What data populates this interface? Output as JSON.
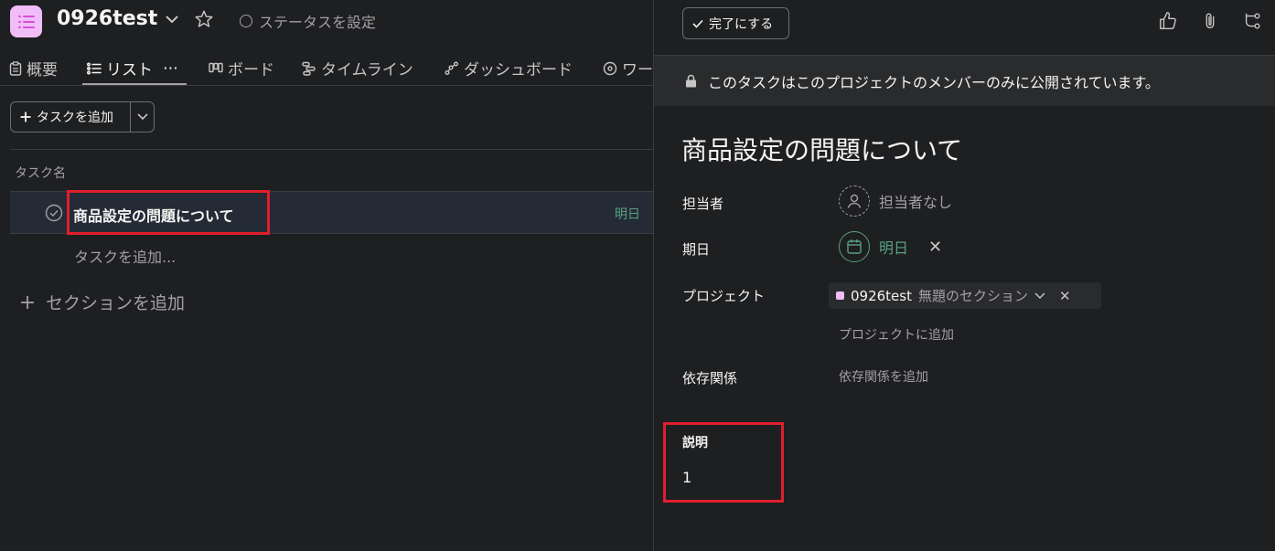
{
  "project": {
    "title": "0926test",
    "status_label": "ステータスを設定",
    "icon_color": "#f1bdf8"
  },
  "tabs": [
    {
      "label": "概要",
      "icon": "clipboard-icon"
    },
    {
      "label": "リスト",
      "icon": "list-icon",
      "active": true,
      "more": "⋯"
    },
    {
      "label": "ボード",
      "icon": "board-icon"
    },
    {
      "label": "タイムライン",
      "icon": "timeline-icon"
    },
    {
      "label": "ダッシュボード",
      "icon": "dashboard-icon"
    },
    {
      "label": "ワー",
      "icon": "workflow-icon"
    }
  ],
  "list": {
    "add_task_label": "タスクを追加",
    "column_header": "タスク名",
    "tasks": [
      {
        "name": "商品設定の問題について",
        "due": "明日"
      }
    ],
    "add_subtask_label": "タスクを追加...",
    "add_section_label": "セクションを追加"
  },
  "detail": {
    "complete_label": "完了にする",
    "privacy_notice": "このタスクはこのプロジェクトのメンバーのみに公開されています。",
    "title": "商品設定の問題について",
    "fields": {
      "assignee_label": "担当者",
      "assignee_value": "担当者なし",
      "due_label": "期日",
      "due_value": "明日",
      "project_label": "プロジェクト",
      "project_name": "0926test",
      "project_section": "無題のセクション",
      "add_project": "プロジェクトに追加",
      "dependency_label": "依存関係",
      "add_dependency": "依存関係を追加"
    },
    "description_label": "説明",
    "description_value": "1"
  },
  "colors": {
    "background": "#1e1f21",
    "due_green": "#58a182",
    "highlight_red": "#e01e2d",
    "selected_row": "#252b36"
  }
}
